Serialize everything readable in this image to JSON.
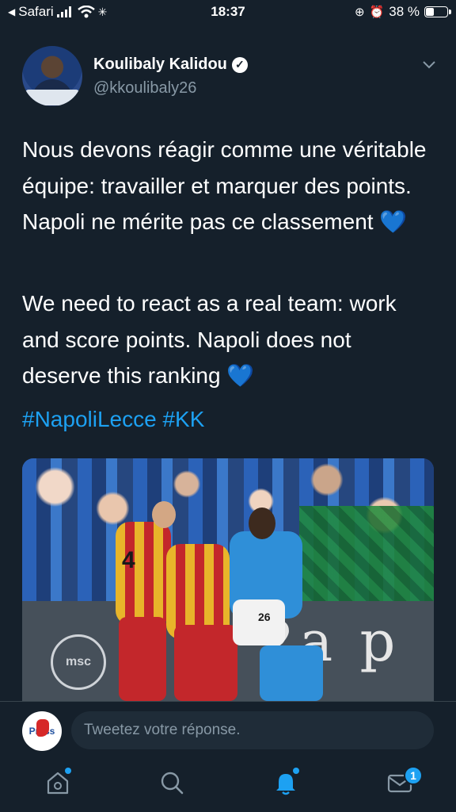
{
  "status_bar": {
    "back_app": "Safari",
    "time": "18:37",
    "battery_percent": "38 %",
    "battery_level": 0.38
  },
  "tweet": {
    "author_name": "Koulibaly Kalidou",
    "author_handle": "@kkoulibaly26",
    "verified": true,
    "text_fr": "Nous devons réagir comme une véritable équipe: travailler et marquer des points. Napoli ne mérite pas ce classement",
    "text_en": "We need to react as a real team: work and score points. Napoli does not deserve this ranking",
    "heart_emoji": "💙",
    "hashtags": "#NapoliLecce #KK",
    "media": {
      "board_text": "2a p",
      "sponsor": "msc",
      "jersey_number_left": "4",
      "jersey_number_right": "26"
    }
  },
  "reply": {
    "placeholder": "Tweetez votre réponse.",
    "avatar_text": "Press"
  },
  "tabs": [
    {
      "name": "home",
      "icon": "home-icon",
      "has_dot": true
    },
    {
      "name": "search",
      "icon": "search-icon",
      "has_dot": false
    },
    {
      "name": "notifications",
      "icon": "bell-icon",
      "has_dot": true,
      "active": true
    },
    {
      "name": "messages",
      "icon": "mail-icon",
      "badge": "1"
    }
  ],
  "colors": {
    "background": "#15202b",
    "accent": "#1da1f2",
    "secondary_text": "#8899a6"
  }
}
